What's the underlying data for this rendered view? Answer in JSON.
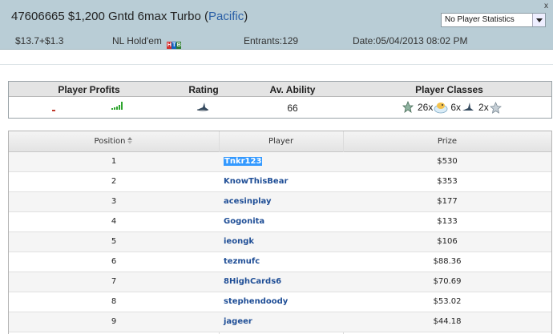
{
  "header": {
    "tournament_id": "47606665",
    "title_rest": " $1,200 Gntd 6max Turbo (",
    "network": "Pacific",
    "title_close": ")",
    "close_label": "x",
    "stats_select": "No Player Statistics",
    "buyin": "$13.7+$1.3",
    "game_type": "NL Hold'em",
    "game_logo_letters": [
      "H",
      "T",
      "B"
    ],
    "game_logo_colors": [
      "#d32f2f",
      "#1565c0",
      "#2e7d32"
    ],
    "entrants": "Entrants:129",
    "date": "Date:05/04/2013 08:02 PM"
  },
  "summary": {
    "headers": {
      "profits": "Player Profits",
      "rating": "Rating",
      "ability": "Av. Ability",
      "classes": "Player Classes"
    },
    "ability_value": "66",
    "rating_icon": "shark-icon",
    "classes": [
      {
        "icon": "star-badge-icon",
        "count": ""
      },
      {
        "icon": "fish-bowl-icon",
        "count": "26x"
      },
      {
        "icon": "shark-icon",
        "count": "6x"
      },
      {
        "icon": "silver-star-icon",
        "count": "2x"
      }
    ],
    "colors": {
      "loss": "#c0392b",
      "win": "#2ea52e"
    }
  },
  "results": {
    "columns": {
      "position": "Position",
      "player": "Player",
      "prize": "Prize"
    },
    "rows": [
      {
        "position": "1",
        "player": "Tnkr123",
        "prize": "$530",
        "selected": true
      },
      {
        "position": "2",
        "player": "KnowThisBear",
        "prize": "$353",
        "selected": false
      },
      {
        "position": "3",
        "player": "acesinplay",
        "prize": "$177",
        "selected": false
      },
      {
        "position": "4",
        "player": "Gogonita",
        "prize": "$133",
        "selected": false
      },
      {
        "position": "5",
        "player": "ieongk",
        "prize": "$106",
        "selected": false
      },
      {
        "position": "6",
        "player": "tezmufc",
        "prize": "$88.36",
        "selected": false
      },
      {
        "position": "7",
        "player": "8HighCards6",
        "prize": "$70.69",
        "selected": false
      },
      {
        "position": "8",
        "player": "stephendoody",
        "prize": "$53.02",
        "selected": false
      },
      {
        "position": "9",
        "player": "jageer",
        "prize": "$44.18",
        "selected": false
      }
    ],
    "colors": {
      "player_link": "#1f4e96",
      "selection": "#3399ff"
    }
  }
}
